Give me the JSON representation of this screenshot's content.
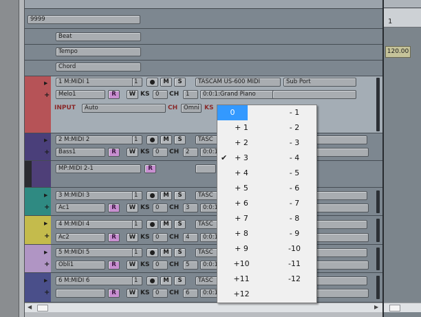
{
  "top_field": "9999",
  "global_tracks": [
    "Beat",
    "Tempo",
    "Chord"
  ],
  "tracks": [
    {
      "id": "1 M:MIDI 1",
      "num": "1",
      "out": "TASCAM US-600 MIDI",
      "port": "Sub Port",
      "name": "Melo1",
      "r": "R",
      "w": "W",
      "ks": "KS",
      "ks_val": "0",
      "ch_label": "CH",
      "ch": "1",
      "patch": "0:0:1:Grand Piano",
      "color": "#b65357",
      "input_label": "INPUT",
      "input": "Auto",
      "input_ch": "Omni"
    },
    {
      "id": "2 M:MIDI 2",
      "num": "1",
      "out": "TASC",
      "name": "Bass1",
      "ks_val": "0",
      "ch": "2",
      "patch": "0:0:1",
      "color": "#4a3f7a"
    },
    {
      "id": "MP:MIDI 2-1",
      "r": "R",
      "color": "#4e3f78"
    },
    {
      "id": "3 M:MIDI 3",
      "num": "1",
      "out": "TASC",
      "name": "Ac1",
      "ks_val": "0",
      "ch": "3",
      "patch": "0:0:1",
      "color": "#2f8a82"
    },
    {
      "id": "4 M:MIDI 4",
      "num": "1",
      "out": "TASC",
      "name": "Ac2",
      "ks_val": "0",
      "ch": "4",
      "patch": "0:0:1",
      "color": "#c4bb4c"
    },
    {
      "id": "5 M:MIDI 5",
      "num": "1",
      "out": "TASC",
      "name": "Obli1",
      "ks_val": "0",
      "ch": "5",
      "patch": "0:0:1",
      "color": "#b095c4"
    },
    {
      "id": "6 M:MIDI 6",
      "num": "1",
      "out": "TASC",
      "name": "",
      "ks_val": "0",
      "ch": "6",
      "patch": "0:0:1",
      "color": "#4a4f8a"
    }
  ],
  "buttons": {
    "rec": "●",
    "mute": "M",
    "solo": "S",
    "r": "R",
    "w": "W",
    "ks": "KS",
    "ch": "CH",
    "expand": "▶",
    "add": "+"
  },
  "right_panel": {
    "measure": "1",
    "tempo": "120.00"
  },
  "dropdown": {
    "selected": "0",
    "checked": "+ 3",
    "left": [
      "0",
      "+ 1",
      "+ 2",
      "+ 3",
      "+ 4",
      "+ 5",
      "+ 6",
      "+ 7",
      "+ 8",
      "+ 9",
      "+10",
      "+11",
      "+12"
    ],
    "right": [
      "- 1",
      "- 2",
      "- 3",
      "- 4",
      "- 5",
      "- 6",
      "- 7",
      "- 8",
      "- 9",
      "-10",
      "-11",
      "-12"
    ],
    "check_icon": "check-icon"
  },
  "scroll": {
    "left_arrow": "◀",
    "right_arrow": "▶"
  }
}
